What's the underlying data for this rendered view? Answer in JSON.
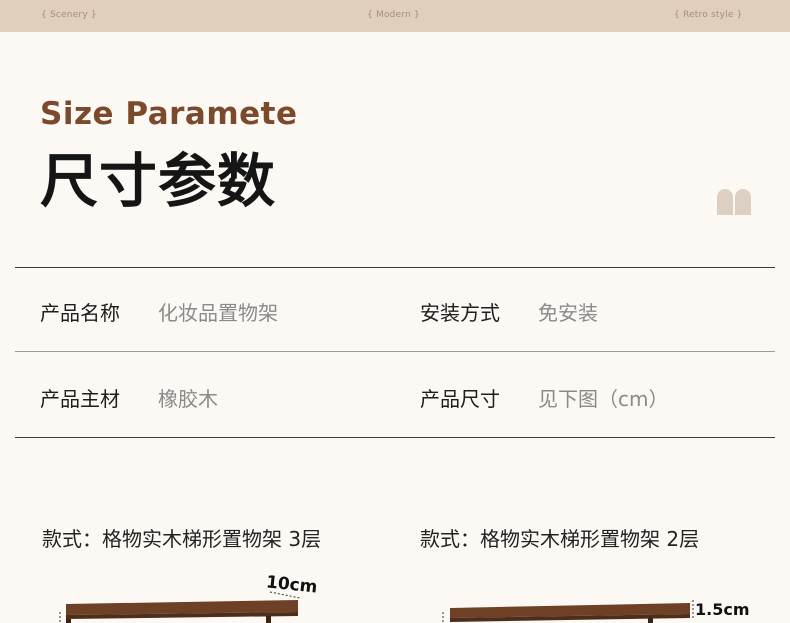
{
  "top_nav": {
    "items": [
      "{ Scenery }",
      "{ Modern }",
      "{ Retro style }"
    ]
  },
  "heading": {
    "en": "Size Paramete",
    "cn": "尺寸参数"
  },
  "specs": [
    {
      "label": "产品名称",
      "value": "化妆品置物架"
    },
    {
      "label": "安装方式",
      "value": "免安装"
    },
    {
      "label": "产品主材",
      "value": "橡胶木"
    },
    {
      "label": "产品尺寸",
      "value": "见下图（cm）"
    }
  ],
  "styles": [
    {
      "label": "款式：格物实木梯形置物架 3层",
      "dimension": "10cm"
    },
    {
      "label": "款式：格物实木梯形置物架 2层",
      "dimension": "1.5cm"
    }
  ],
  "colors": {
    "topbar": "#e0cfbc",
    "accent": "#7a4a2b",
    "background": "#fcf9f5",
    "wood": "#6e4127",
    "deco": "#ddd0c2"
  }
}
